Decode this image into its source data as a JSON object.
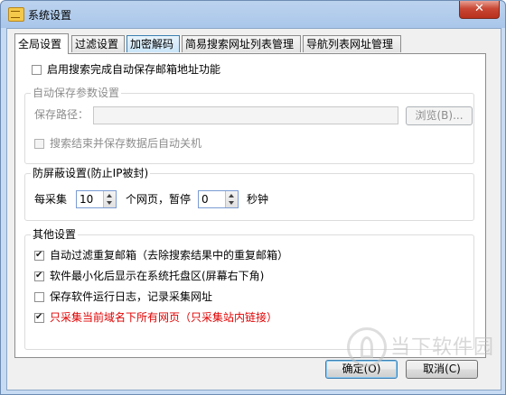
{
  "window": {
    "title": "系统设置",
    "close_label": "✕"
  },
  "tabs": [
    {
      "label": "全局设置",
      "active": true
    },
    {
      "label": "过滤设置",
      "active": false
    },
    {
      "label": "加密解码",
      "active": false
    },
    {
      "label": "简易搜索网址列表管理",
      "active": false
    },
    {
      "label": "导航列表网址管理",
      "active": false
    }
  ],
  "global": {
    "auto_save_email": {
      "label": "启用搜索完成自动保存邮箱地址功能",
      "checked": false
    },
    "auto_save_group": {
      "title": "自动保存参数设置",
      "path_label": "保存路径：",
      "path_value": "",
      "browse_label": "浏览(B)...",
      "shutdown": {
        "label": "搜索结束并保存数据后自动关机",
        "checked": false
      }
    },
    "anti_block_group": {
      "title": "防屏蔽设置(防止IP被封)",
      "every_label": "每采集",
      "pages_value": "10",
      "pages_label": "个网页，暂停",
      "pause_value": "0",
      "seconds_label": "秒钟"
    },
    "other_group": {
      "title": "其他设置",
      "options": [
        {
          "label": "自动过滤重复邮箱（去除搜索结果中的重复邮箱）",
          "checked": true,
          "highlight": false
        },
        {
          "label": "软件最小化后显示在系统托盘区(屏幕右下角)",
          "checked": true,
          "highlight": false
        },
        {
          "label": "保存软件运行日志，记录采集网址",
          "checked": false,
          "highlight": false
        },
        {
          "label": "只采集当前域名下所有网页（只采集站内链接）",
          "checked": true,
          "highlight": true
        }
      ]
    }
  },
  "buttons": {
    "ok_label": "确定(O)",
    "cancel_label": "取消(C)"
  },
  "watermark": {
    "text": "当下软件园"
  }
}
